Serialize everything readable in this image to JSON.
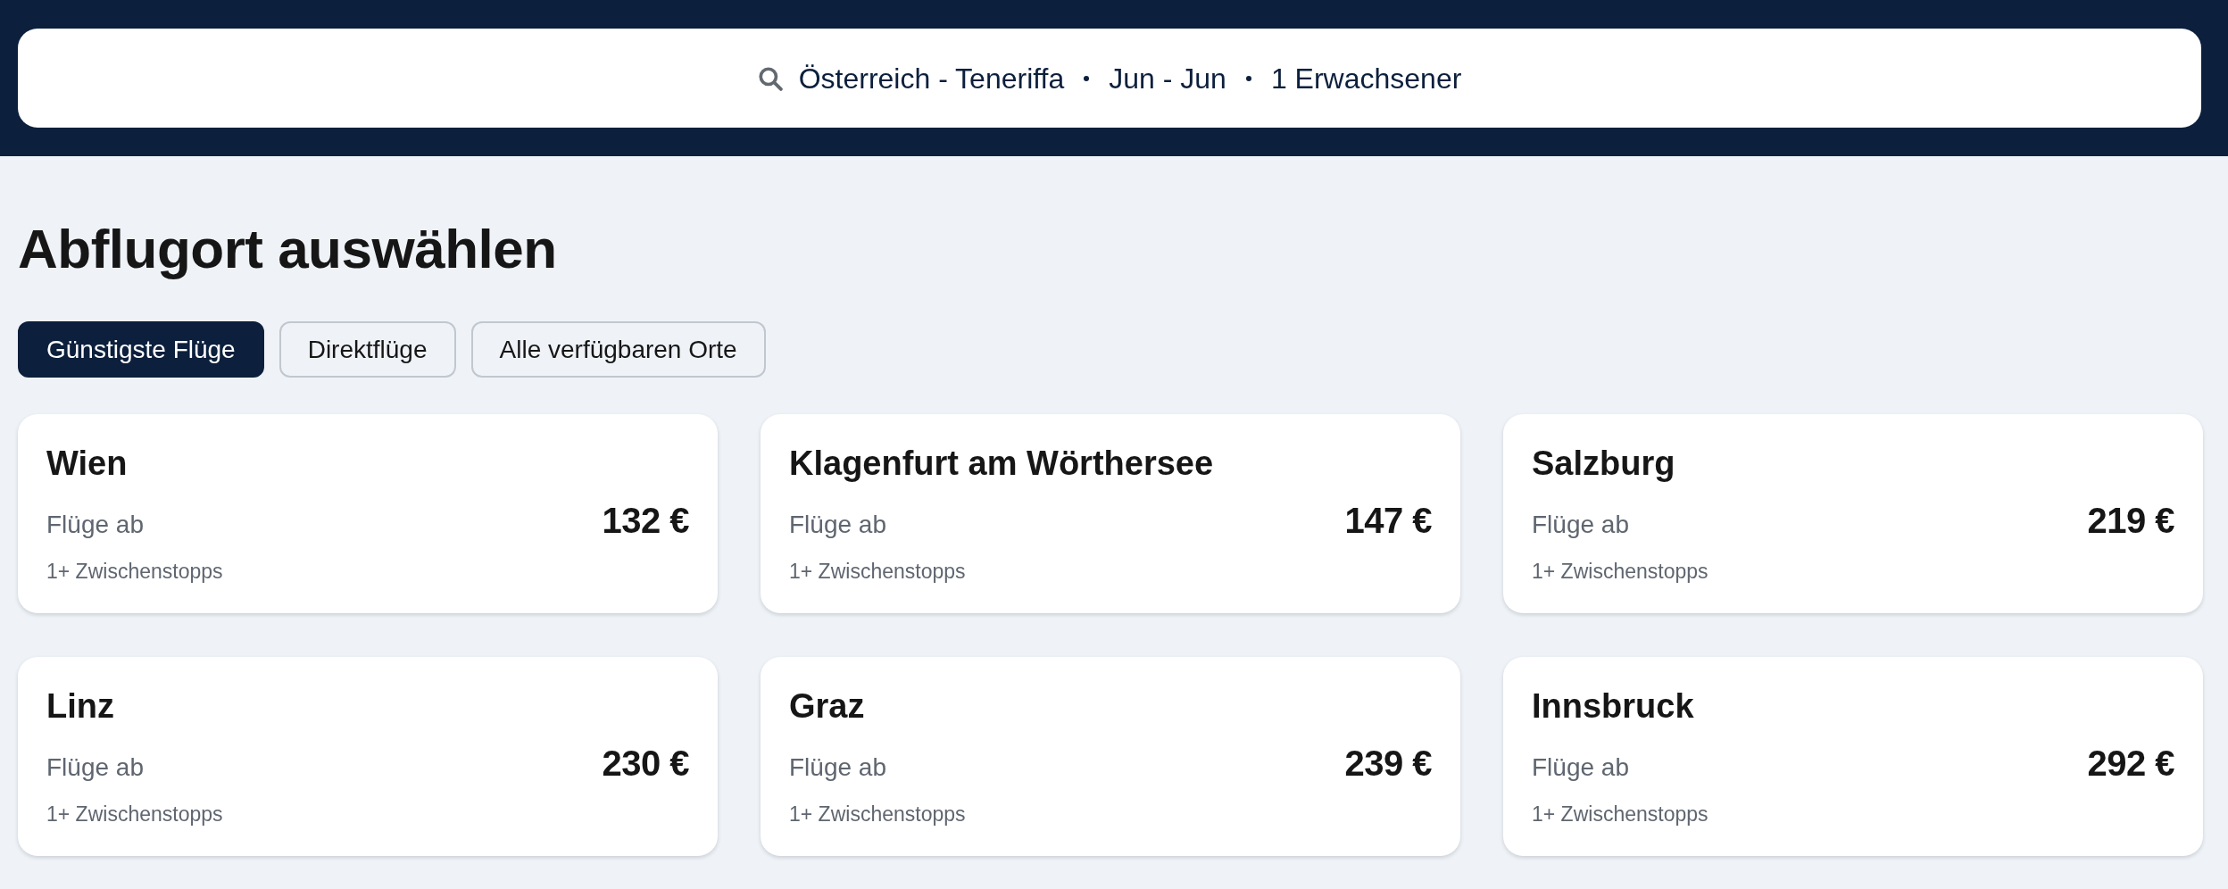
{
  "search_summary": {
    "route": "Österreich - Teneriffa",
    "dates": "Jun - Jun",
    "travellers": "1 Erwachsener"
  },
  "title": "Abflugort auswählen",
  "filters": [
    {
      "label": "Günstigste Flüge",
      "selected": true
    },
    {
      "label": "Direktflüge",
      "selected": false
    },
    {
      "label": "Alle verfügbaren Orte",
      "selected": false
    }
  ],
  "destinations": [
    {
      "city": "Wien",
      "price_label": "Flüge ab",
      "price": "132 €",
      "stops": "1+ Zwischenstopps"
    },
    {
      "city": "Klagenfurt am Wörthersee",
      "price_label": "Flüge ab",
      "price": "147 €",
      "stops": "1+ Zwischenstopps"
    },
    {
      "city": "Salzburg",
      "price_label": "Flüge ab",
      "price": "219 €",
      "stops": "1+ Zwischenstopps"
    },
    {
      "city": "Linz",
      "price_label": "Flüge ab",
      "price": "230 €",
      "stops": "1+ Zwischenstopps"
    },
    {
      "city": "Graz",
      "price_label": "Flüge ab",
      "price": "239 €",
      "stops": "1+ Zwischenstopps"
    },
    {
      "city": "Innsbruck",
      "price_label": "Flüge ab",
      "price": "292 €",
      "stops": "1+ Zwischenstopps"
    }
  ]
}
